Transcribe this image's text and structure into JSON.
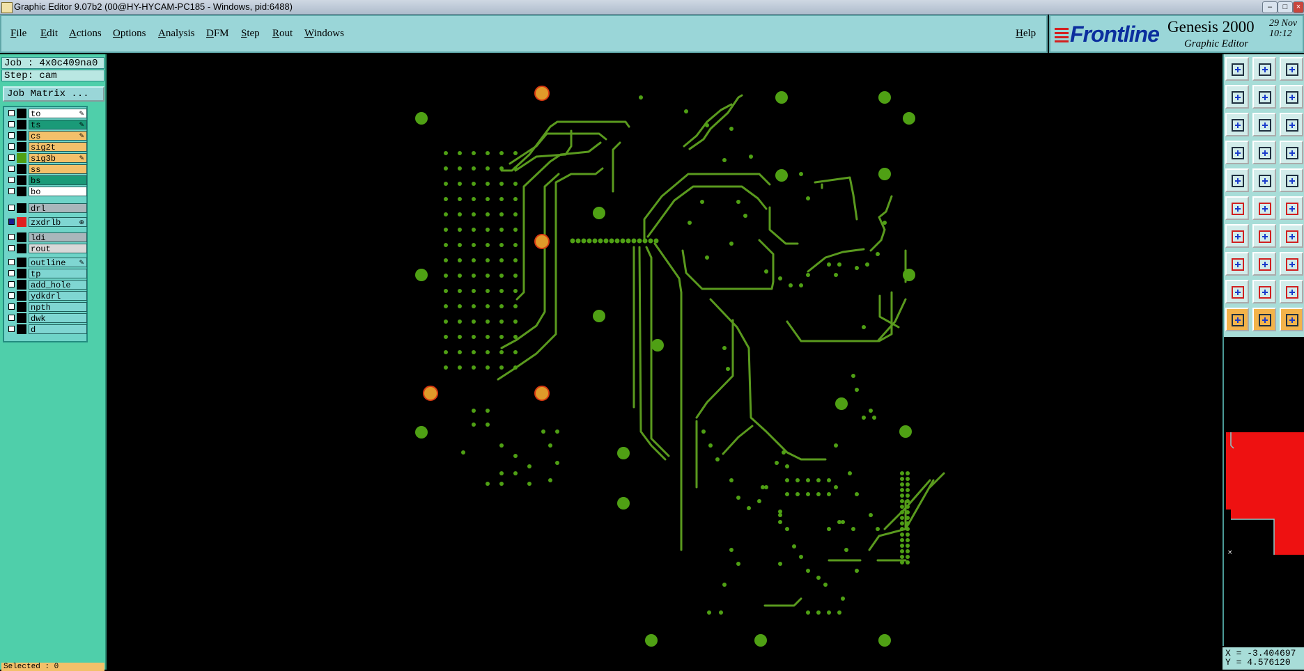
{
  "window": {
    "title": "Graphic Editor 9.07b2 (00@HY-HYCAM-PC185 - Windows, pid:6488)"
  },
  "menu": {
    "items": [
      "File",
      "Edit",
      "Actions",
      "Options",
      "Analysis",
      "DFM",
      "Step",
      "Rout",
      "Windows"
    ],
    "help": "Help"
  },
  "brand": {
    "logo": "Frontline",
    "product": "Genesis 2000",
    "subtitle": "Graphic Editor",
    "date": "29 Nov\n10:12"
  },
  "job": {
    "job_label": "Job : 4x0c409na0",
    "step_label": "Step: cam",
    "matrix_button": "Job Matrix ..."
  },
  "layers": [
    {
      "name": "to",
      "color": "#ffffff",
      "mark": "✎"
    },
    {
      "name": "ts",
      "color": "#1a9a78",
      "mark": "✎"
    },
    {
      "name": "cs",
      "color": "#f3c06a",
      "mark": "✎"
    },
    {
      "name": "sig2t",
      "color": "#f3c06a",
      "mark": ""
    },
    {
      "name": "sig3b",
      "color": "#f3c06a",
      "mark": "✎",
      "active": true
    },
    {
      "name": "ss",
      "color": "#f3c06a",
      "mark": ""
    },
    {
      "name": "bs",
      "color": "#1a9a78",
      "mark": ""
    },
    {
      "name": "bo",
      "color": "#ffffff",
      "mark": ""
    },
    {
      "name": "drl",
      "color": "#a9b6bb",
      "mark": ""
    },
    {
      "name": "zxdrlb",
      "color": "#7fd6d2",
      "mark": "⊕",
      "checked": true,
      "swatch": "#e02020"
    },
    {
      "name": "ldi",
      "color": "#a9b6bb",
      "mark": ""
    },
    {
      "name": "rout",
      "color": "#d8d8d8",
      "mark": ""
    },
    {
      "name": "outline",
      "color": "#7fd6d2",
      "mark": "✎"
    },
    {
      "name": "tp",
      "color": "#7fd6d2",
      "mark": ""
    },
    {
      "name": "add_hole",
      "color": "#7fd6d2",
      "mark": ""
    },
    {
      "name": "ydkdrl",
      "color": "#7fd6d2",
      "mark": ""
    },
    {
      "name": "npth",
      "color": "#7fd6d2",
      "mark": ""
    },
    {
      "name": "dwk",
      "color": "#7fd6d2",
      "mark": ""
    },
    {
      "name": "d",
      "color": "#7fd6d2",
      "mark": ""
    }
  ],
  "status": {
    "selected": "Selected : 0",
    "coords": "X = -3.404697\nY = 4.576120"
  },
  "colors": {
    "trace": "#5a9a1e",
    "pad": "#4fa014",
    "highlight_pad": "#e09a2a",
    "highlight_ring": "#d83a12",
    "overview": "#ee1111"
  }
}
